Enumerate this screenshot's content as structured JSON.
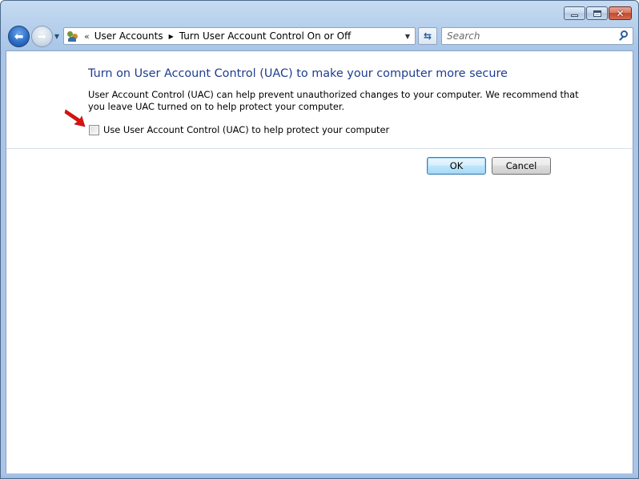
{
  "window": {
    "caption": {
      "minimize": "minimize",
      "maximize": "maximize",
      "close": "close"
    }
  },
  "navbar": {
    "breadcrumb": {
      "overflow_glyph": "«",
      "items": [
        "User Accounts",
        "Turn User Account Control On or Off"
      ]
    },
    "search": {
      "placeholder": "Search"
    }
  },
  "content": {
    "heading": "Turn on User Account Control (UAC) to make your computer more secure",
    "description_lines": [
      "User Account Control (UAC) can help prevent unauthorized changes to your computer.  We recommend that",
      "you leave UAC turned on to help protect your computer."
    ],
    "checkbox": {
      "label": "Use User Account Control (UAC) to help protect your computer",
      "checked": false
    },
    "buttons": {
      "ok": "OK",
      "cancel": "Cancel"
    }
  },
  "colors": {
    "heading": "#1e3d8f",
    "annotation_arrow": "#e01010",
    "chrome": "#b7d0ec"
  }
}
